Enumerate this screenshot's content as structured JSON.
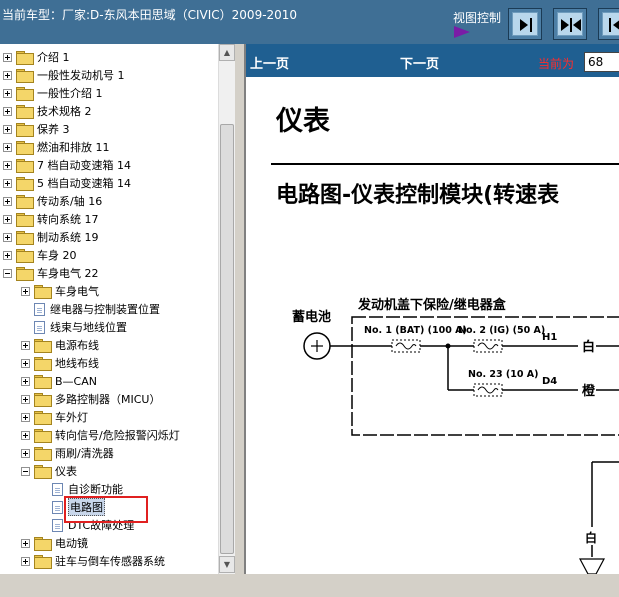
{
  "header": {
    "title": "当前车型：厂家:D-东风本田思域（CIVIC）2009-2010",
    "view_control_label": "视图控制"
  },
  "tree": {
    "items": [
      {
        "label": "介绍 1"
      },
      {
        "label": "一般性发动机号 1"
      },
      {
        "label": "一般性介绍 1"
      },
      {
        "label": "技术规格 2"
      },
      {
        "label": "保养 3"
      },
      {
        "label": "燃油和排放 11"
      },
      {
        "label": "7 档自动变速箱 14"
      },
      {
        "label": "5 档自动变速箱 14"
      },
      {
        "label": "传动系/轴 16"
      },
      {
        "label": "转向系统 17"
      },
      {
        "label": "制动系统 19"
      },
      {
        "label": "车身 20"
      },
      {
        "label": "车身电气 22"
      },
      {
        "label": "车身电气"
      },
      {
        "label": "继电器与控制装置位置"
      },
      {
        "label": "线束与地线位置"
      },
      {
        "label": "电源布线"
      },
      {
        "label": "地线布线"
      },
      {
        "label": "B—CAN"
      },
      {
        "label": "多路控制器（MICU）"
      },
      {
        "label": "车外灯"
      },
      {
        "label": "转向信号/危险报警闪烁灯"
      },
      {
        "label": "雨刷/清洗器"
      },
      {
        "label": "仪表"
      },
      {
        "label": "自诊断功能"
      },
      {
        "label": "电路图"
      },
      {
        "label": "DTC故障处理"
      },
      {
        "label": "电动镜"
      },
      {
        "label": "驻车与倒车传感器系统"
      }
    ]
  },
  "nav": {
    "prev_label": "上一页",
    "next_label": "下一页",
    "current_label": "当前为",
    "current_page": "68"
  },
  "document": {
    "title": "仪表",
    "subtitle": "电路图-仪表控制模块(转速表",
    "diagram": {
      "box_title": "发动机盖下保险/继电器盒",
      "battery_label": "蓄电池",
      "fuse1": "No. 1 (BAT) (100 A)",
      "fuse2": "No. 2 (IG) (50 A)",
      "fuse3": "No. 23 (10 A)",
      "wire_h1": "H1",
      "wire_d4": "D4",
      "color_white": "白",
      "color_orange": "橙",
      "color_white2": "白"
    }
  },
  "colors": {
    "header_bg": "#3f6f95",
    "navbar_bg": "#1f5f91",
    "highlight_red": "#e02020",
    "current_label": "#ff2b2b"
  }
}
